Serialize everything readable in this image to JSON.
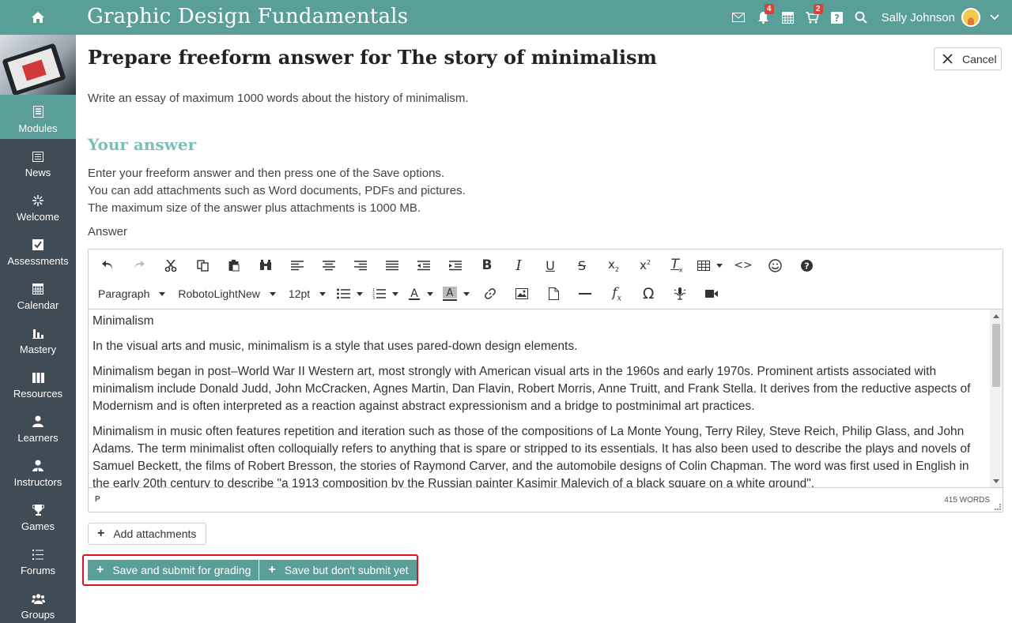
{
  "topbar": {
    "course_title": "Graphic Design Fundamentals",
    "user_name": "Sally Johnson",
    "notifications_count": "4",
    "cart_count": "2",
    "icons": [
      "home-icon",
      "mail-icon",
      "bell-icon",
      "calendar-icon",
      "cart-icon",
      "help-icon",
      "search-icon",
      "avatar",
      "chevron-down-icon"
    ]
  },
  "sidebar": {
    "items": [
      {
        "label": "Modules",
        "icon": "modules-icon",
        "active": true
      },
      {
        "label": "News",
        "icon": "news-icon"
      },
      {
        "label": "Welcome",
        "icon": "welcome-icon"
      },
      {
        "label": "Assessments",
        "icon": "assessments-icon"
      },
      {
        "label": "Calendar",
        "icon": "calendar-icon"
      },
      {
        "label": "Mastery",
        "icon": "mastery-icon"
      },
      {
        "label": "Resources",
        "icon": "resources-icon"
      },
      {
        "label": "Learners",
        "icon": "learners-icon"
      },
      {
        "label": "Instructors",
        "icon": "instructors-icon"
      },
      {
        "label": "Games",
        "icon": "trophy-icon"
      },
      {
        "label": "Forums",
        "icon": "forums-icon"
      },
      {
        "label": "Groups",
        "icon": "groups-icon"
      }
    ]
  },
  "page": {
    "title": "Prepare freeform answer for The story of minimalism",
    "cancel_label": "Cancel",
    "instructions": "Write an essay of maximum 1000 words about the history of minimalism.",
    "section_title": "Your answer",
    "help_lines": [
      "Enter your freeform answer and then press one of the Save options.",
      "You can add attachments such as Word documents, PDFs and pictures.",
      "The maximum size of the answer plus attachments is 1000 MB."
    ],
    "answer_label": "Answer"
  },
  "editor": {
    "format_select": "Paragraph",
    "font_select": "RobotoLightNew",
    "size_select": "12pt",
    "status_path": "P",
    "word_count": "415 WORDS",
    "paragraphs": [
      "Minimalism",
      "In the visual arts and music, minimalism is a style that uses pared-down design elements.",
      "Minimalism began in post–World War II Western art, most strongly with American visual arts in the 1960s and early 1970s. Prominent artists associated with minimalism include Donald Judd, John McCracken, Agnes Martin, Dan Flavin, Robert Morris, Anne Truitt, and Frank Stella. It derives from the reductive aspects of Modernism and is often interpreted as a reaction against abstract expressionism and a bridge to postminimal art practices.",
      "Minimalism in music often features repetition and iteration such as those of the compositions of La Monte Young, Terry Riley, Steve Reich, Philip Glass, and John Adams. The term minimalist often colloquially refers to anything that is spare or stripped to its essentials. It has also been used to describe the plays and novels of Samuel Beckett, the films of Robert Bresson, the stories of Raymond Carver, and the automobile designs of Colin Chapman. The word was first used in English in the early 20th century to describe \"a 1913 composition by the Russian painter Kasimir Malevich of a black square on a white ground\"."
    ]
  },
  "actions": {
    "add_attachments": "Add attachments",
    "save_submit": "Save and submit for grading",
    "save_no_submit": "Save but don't submit yet"
  },
  "colors": {
    "accent": "#5a9e98",
    "sidebar_bg": "#3f4b55",
    "section_title": "#7bbfb8",
    "highlight": "#e0141e",
    "badge": "#d9443a"
  }
}
